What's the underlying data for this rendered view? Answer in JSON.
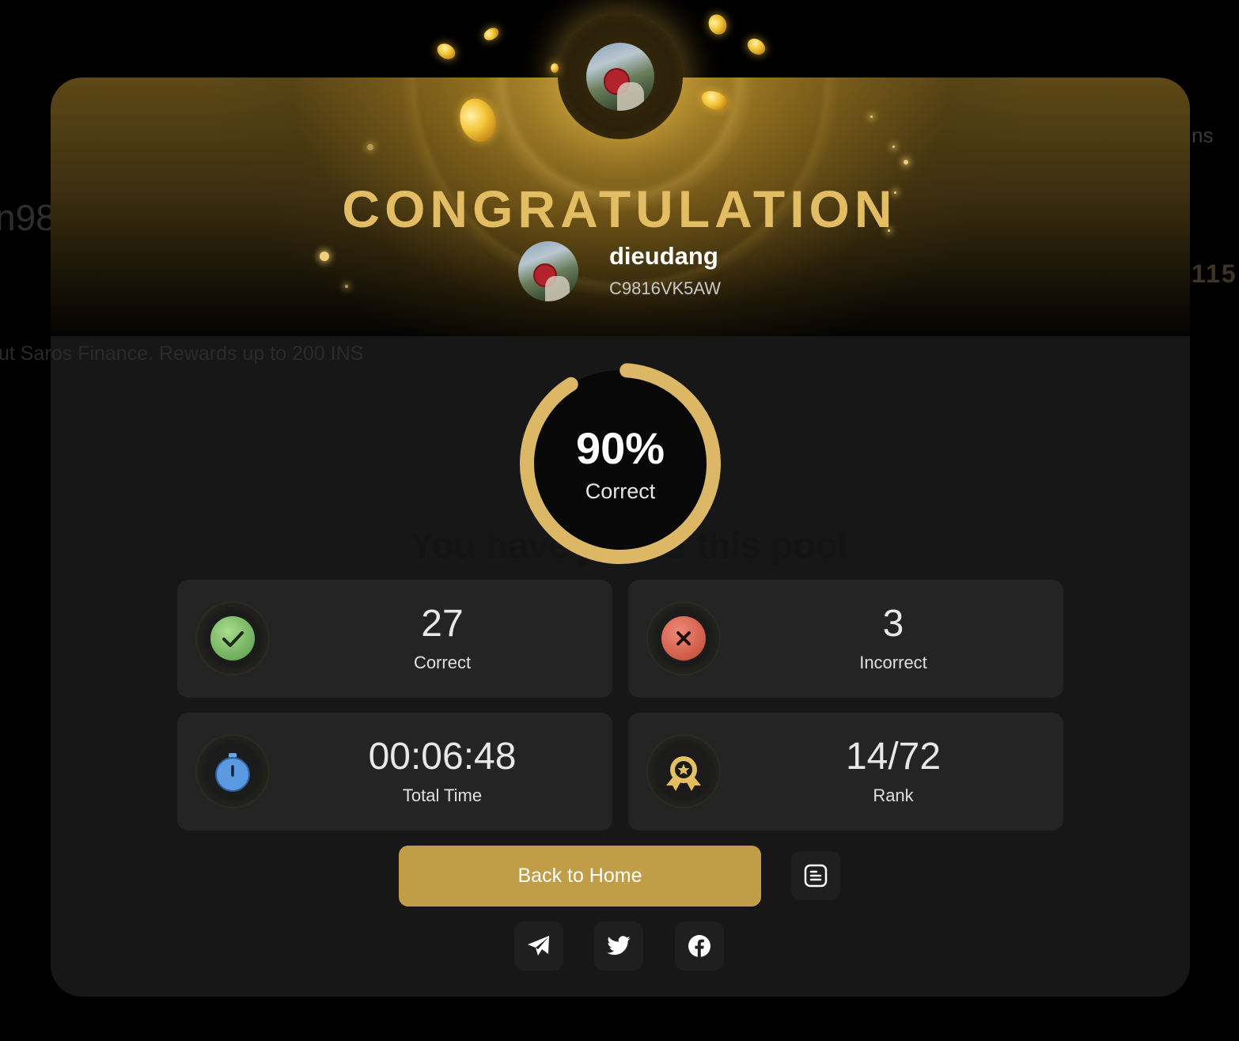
{
  "background": {
    "left_text": "n98",
    "right_word": "ns",
    "right_number": "115",
    "subtitle": "ut Saros Finance. Rewards up to 200 INS",
    "pool_message": "You have joined this pool"
  },
  "modal": {
    "title": "CONGRATULATION",
    "user": {
      "name": "dieudang",
      "code": "C9816VK5AW"
    },
    "score": {
      "percent_text": "90%",
      "percent_value": 0.9,
      "label": "Correct"
    },
    "stats": [
      {
        "value": "27",
        "label": "Correct",
        "icon": "check-icon",
        "color": "#7fbf6a"
      },
      {
        "value": "3",
        "label": "Incorrect",
        "icon": "close-icon",
        "color": "#d15a4b"
      },
      {
        "value": "00:06:48",
        "label": "Total Time",
        "icon": "stopwatch-icon",
        "color": "#4f90d9"
      },
      {
        "value": "14/72",
        "label": "Rank",
        "icon": "medal-icon",
        "color": "#e0b85a"
      }
    ],
    "actions": {
      "home_label": "Back to Home",
      "detail_icon": "document-icon"
    },
    "share": [
      "telegram-icon",
      "twitter-icon",
      "facebook-icon"
    ]
  },
  "colors": {
    "accent": "#e3bd64",
    "button": "#c29d48",
    "card": "#242424",
    "modal": "#171717"
  }
}
